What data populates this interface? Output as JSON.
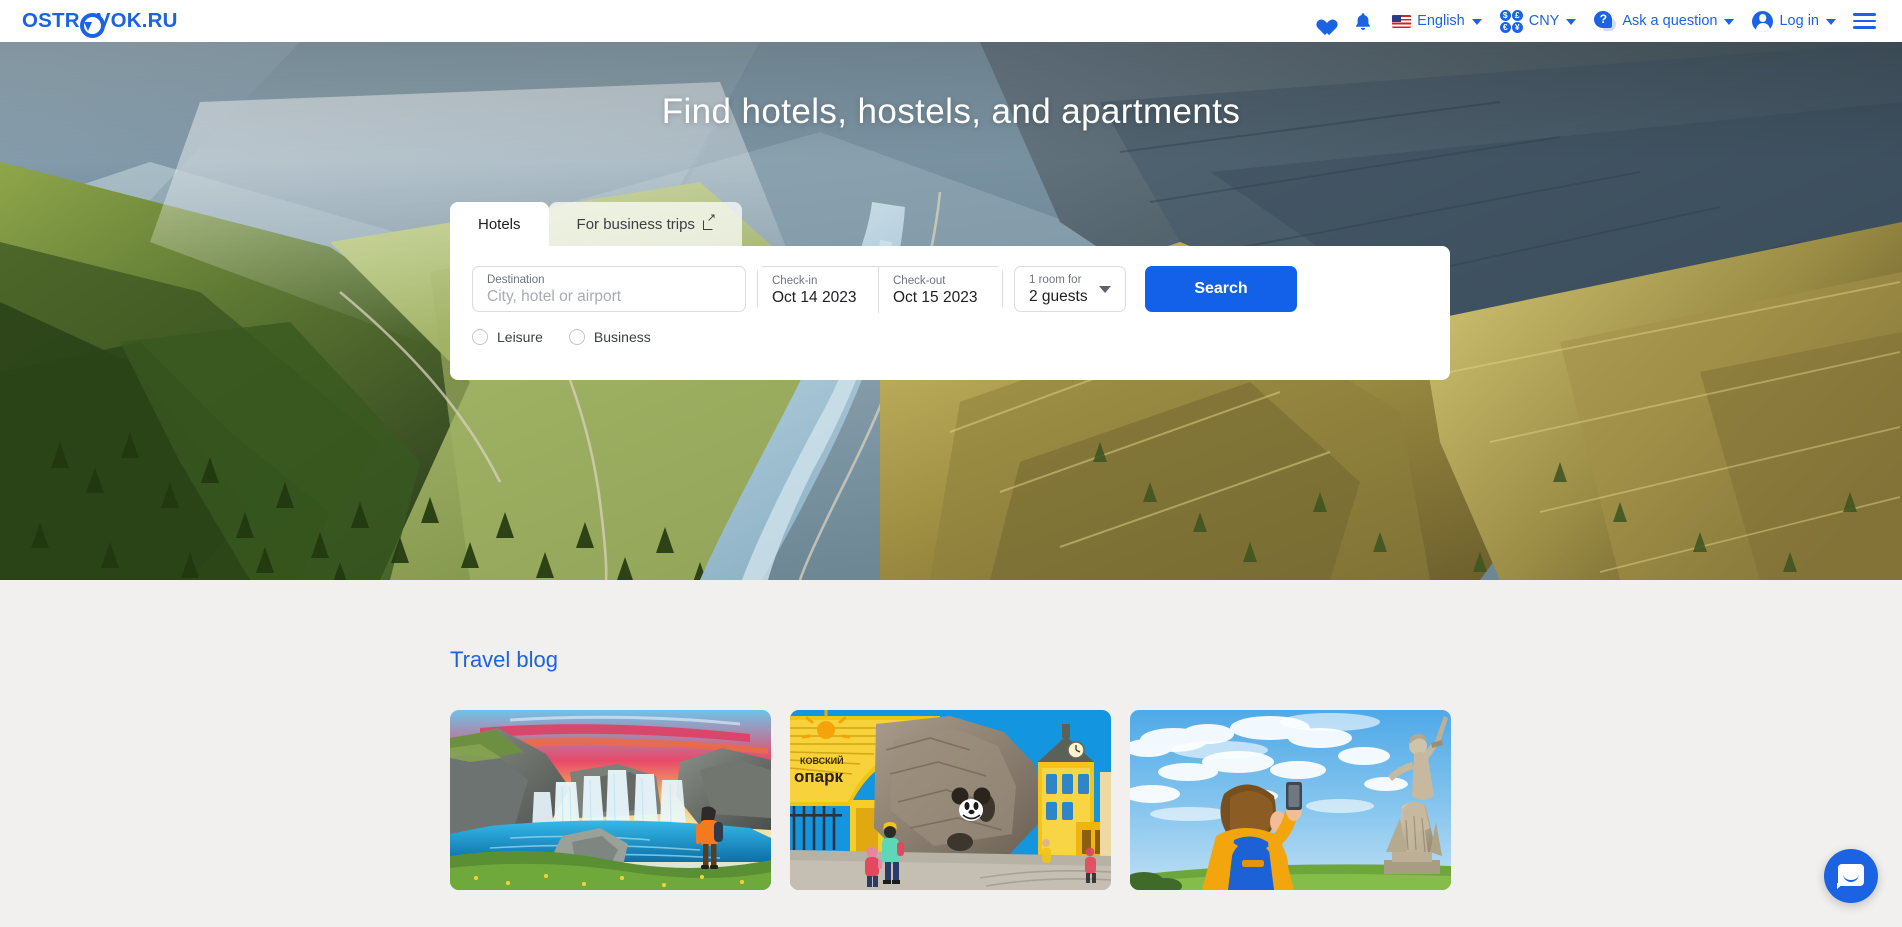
{
  "header": {
    "logo": {
      "prefix": "OSTR",
      "suffix": "VOK.RU",
      "color": "#1B63E3"
    },
    "favorites_icon": "heart-icon",
    "notifications_icon": "bell-icon",
    "language": {
      "label": "English",
      "flag": "us-flag-icon"
    },
    "currency": {
      "label": "CNY",
      "symbols": [
        "$",
        "£",
        "€",
        "¥"
      ]
    },
    "help": {
      "label": "Ask a question",
      "icon": "question-bubble-icon"
    },
    "account": {
      "label": "Log in",
      "icon": "avatar-icon"
    },
    "menu_icon": "hamburger-menu-icon"
  },
  "hero": {
    "title": "Find hotels, hostels, and apartments",
    "image_alt": "mountain-valley-river-aerial"
  },
  "search": {
    "tabs": [
      {
        "label": "Hotels",
        "active": true
      },
      {
        "label": "For business trips",
        "active": false,
        "icon": "external-link-icon"
      }
    ],
    "destination": {
      "label": "Destination",
      "placeholder": "City, hotel or airport",
      "value": ""
    },
    "checkin": {
      "label": "Check-in",
      "value": "Oct 14 2023"
    },
    "checkout": {
      "label": "Check-out",
      "value": "Oct 15 2023"
    },
    "guests": {
      "label": "1 room for",
      "value": "2 guests"
    },
    "submit_label": "Search",
    "accent_color": "#1361E8",
    "trip_type": [
      {
        "label": "Leisure",
        "selected": false
      },
      {
        "label": "Business",
        "selected": false
      }
    ]
  },
  "blog": {
    "title": "Travel blog",
    "cards": [
      {
        "image_alt": "waterfall-hiker-iceland"
      },
      {
        "image_alt": "moscow-zoo-entrance-family"
      },
      {
        "image_alt": "motherland-calls-statue-tourist"
      }
    ]
  },
  "chat": {
    "icon": "chat-bubble-icon"
  }
}
